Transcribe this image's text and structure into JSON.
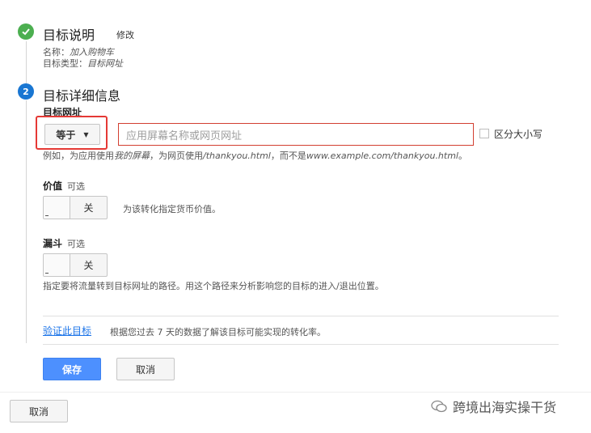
{
  "step1": {
    "number": "",
    "title": "目标说明",
    "edit_link": "修改",
    "name_label": "名称：",
    "name_value": "加入购物车",
    "type_label": "目标类型：",
    "type_value": "目标网址"
  },
  "step2": {
    "number": "2",
    "title": "目标详细信息"
  },
  "destination": {
    "label": "目标网址",
    "match_type": "等于",
    "placeholder": "应用屏幕名称或网页网址",
    "case_sensitive_label": "区分大小写",
    "hint_prefix": "例如，为应用使用",
    "hint_app": "我的屏幕",
    "hint_mid": "，为网页使用",
    "hint_web": "/thankyou.html",
    "hint_not": "，而不是",
    "hint_full": "www.example.com/thankyou.html",
    "hint_end": "。"
  },
  "value": {
    "label": "价值",
    "optional": "可选",
    "toggle_state": "关",
    "description": "为该转化指定货币价值。"
  },
  "funnel": {
    "label": "漏斗",
    "optional": "可选",
    "toggle_state": "关",
    "description": "指定要将流量转到目标网址的路径。用这个路径来分析影响您的目标的进入/退出位置。"
  },
  "verify": {
    "link": "验证此目标",
    "description": "根据您过去 7 天的数据了解该目标可能实现的转化率。"
  },
  "actions": {
    "save": "保存",
    "cancel": "取消",
    "bottom_cancel": "取消"
  },
  "watermark": {
    "text": "跨境出海实操干货"
  },
  "colors": {
    "step_done": "#4caf50",
    "step_active": "#1976d2",
    "primary_button": "#4d90fe",
    "highlight_border": "#e53935",
    "input_error_border": "#d23f31"
  }
}
